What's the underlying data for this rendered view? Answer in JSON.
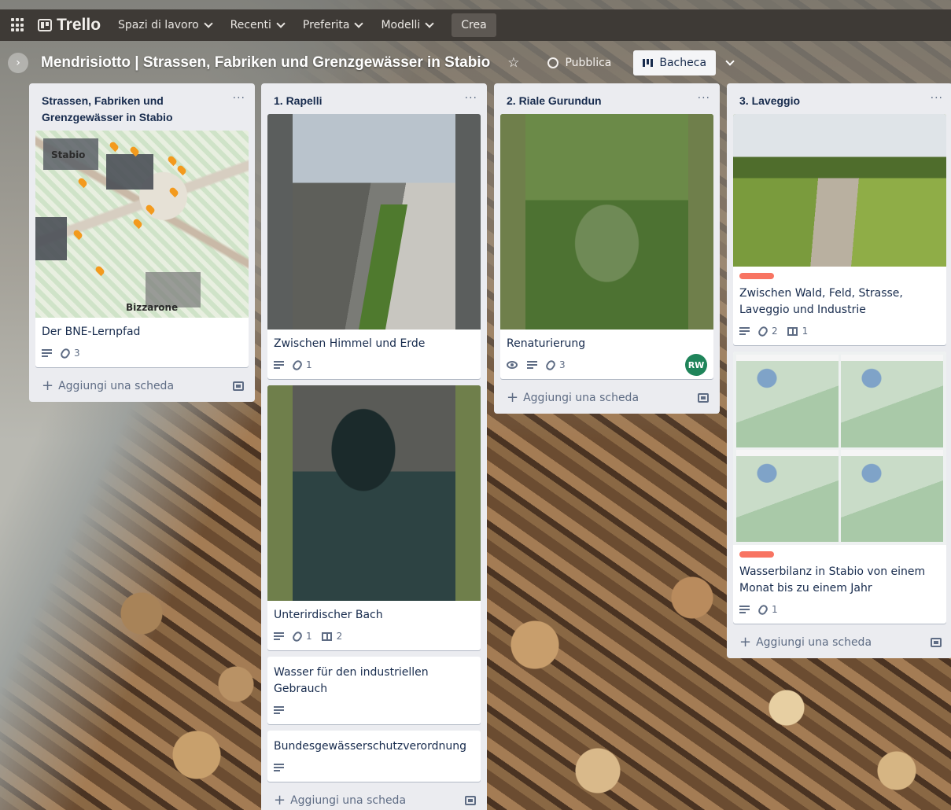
{
  "nav": {
    "logo": "Trello",
    "items": [
      "Spazi di lavoro",
      "Recenti",
      "Preferita",
      "Modelli"
    ],
    "create": "Crea"
  },
  "board": {
    "title": "Mendrisiotto | Strassen, Fabriken und Grenzgewässer in Stabio",
    "visibility": "Pubblica",
    "view": "Bacheca"
  },
  "colors": {
    "label_red": "#f87462",
    "avatar_green": "#1f845a",
    "nav_bg": "#3e3a36"
  },
  "lists": [
    {
      "title": "Strassen, Fabriken und Grenzgewässer in Stabio",
      "cards": [
        {
          "title": "Der BNE-Lernpfad",
          "attachments": "3",
          "map_labels": [
            "Stabio",
            "Bizzarone"
          ]
        }
      ],
      "add": "Aggiungi una scheda"
    },
    {
      "title": "1. Rapelli",
      "cards": [
        {
          "title": "Zwischen Himmel und Erde",
          "attachments": "1"
        },
        {
          "title": "Unterirdischer Bach",
          "attachments": "1",
          "checklist": "2"
        },
        {
          "title": "Wasser für den industriellen Gebrauch"
        },
        {
          "title": "Bundesgewässerschutzverordnung"
        }
      ],
      "add": "Aggiungi una scheda"
    },
    {
      "title": "2. Riale Gurundun",
      "cards": [
        {
          "title": "Renaturierung",
          "attachments": "3",
          "member": "RW"
        }
      ],
      "add": "Aggiungi una scheda"
    },
    {
      "title": "3. Laveggio",
      "cards": [
        {
          "title": "Zwischen Wald, Feld, Strasse, Laveggio und Industrie",
          "attachments": "2",
          "checklist": "1"
        },
        {
          "title": "Wasserbilanz in Stabio von einem Monat bis zu einem Jahr",
          "attachments": "1"
        }
      ],
      "add": "Aggiungi una scheda"
    }
  ]
}
